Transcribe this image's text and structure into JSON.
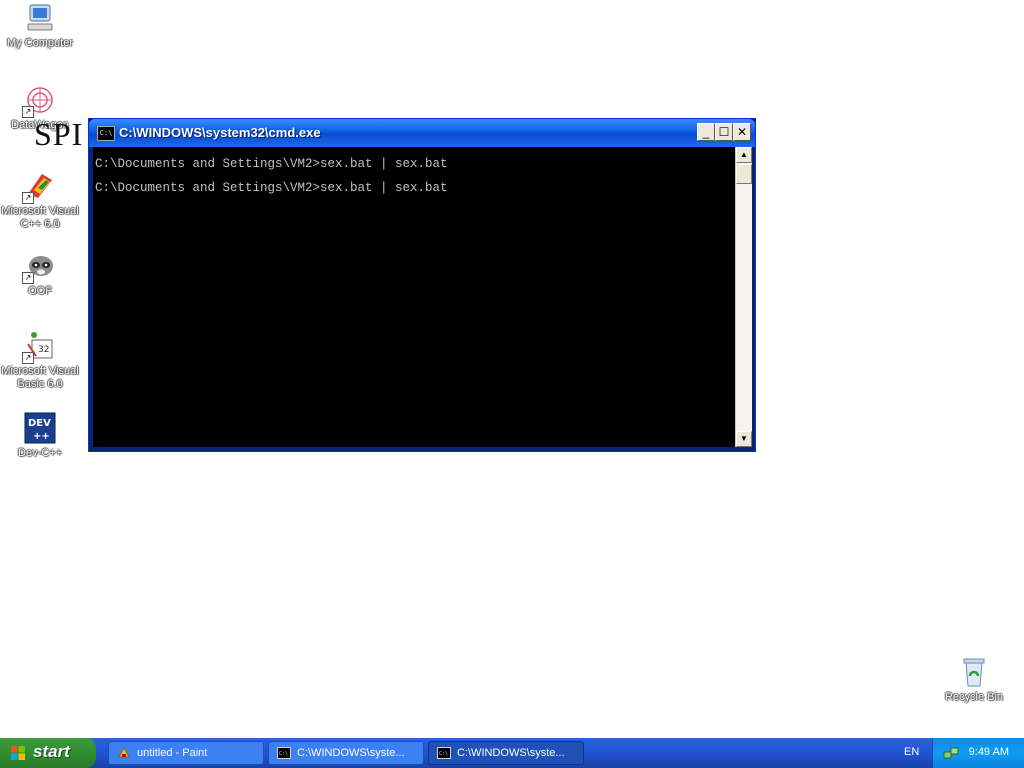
{
  "desktop": {
    "icons": [
      {
        "label": "My Computer"
      },
      {
        "label": "DataWagon"
      },
      {
        "label": "Microsoft Visual C++ 6.0"
      },
      {
        "label": "OOF"
      },
      {
        "label": "Microsoft Visual Basic 6.0"
      },
      {
        "label": "Dev-C++"
      },
      {
        "label": "Recycle Bin"
      }
    ],
    "overlay_text": "SPI"
  },
  "cmd_window": {
    "title": "C:\\WINDOWS\\system32\\cmd.exe",
    "icon_text": "C:\\",
    "lines": [
      "C:\\Documents and Settings\\VM2>sex.bat | sex.bat",
      "C:\\Documents and Settings\\VM2>sex.bat | sex.bat"
    ]
  },
  "taskbar": {
    "start_label": "start",
    "tasks": [
      {
        "label": "untitled - Paint"
      },
      {
        "label": "C:\\WINDOWS\\syste..."
      },
      {
        "label": "C:\\WINDOWS\\syste..."
      }
    ],
    "language": "EN",
    "clock": "9:49 AM"
  },
  "colors": {
    "console_bg": "#000000",
    "console_text": "#c0c0c0",
    "titlebar_blue": "#0a5fdc",
    "taskbar_blue": "#2453d4",
    "start_green": "#2f8f2f"
  }
}
